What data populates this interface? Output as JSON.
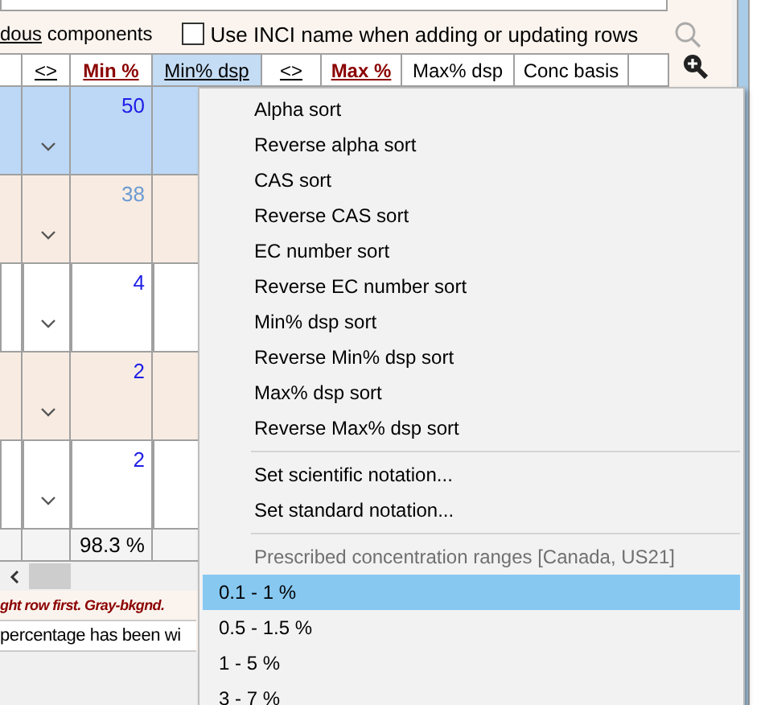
{
  "toolbar": {
    "link_text": "dous",
    "label": "components",
    "checkbox": {
      "label": "Use INCI name when adding or updating rows",
      "checked": false
    }
  },
  "table": {
    "columns": [
      {
        "kind": "plain",
        "selected": false
      },
      {
        "label": "<>",
        "kind": "toggle",
        "selected": false
      },
      {
        "label": "Min %",
        "kind": "key",
        "selected": false
      },
      {
        "label": "Min% dsp",
        "kind": "link",
        "selected": true
      },
      {
        "label": "<>",
        "kind": "toggle",
        "selected": false
      },
      {
        "label": "Max %",
        "kind": "key",
        "selected": false
      },
      {
        "label": "Max% dsp",
        "kind": "plain",
        "selected": false
      },
      {
        "label": "Conc basis",
        "kind": "plain",
        "selected": false
      },
      {
        "kind": "plain",
        "selected": false
      }
    ],
    "rows": [
      {
        "min": "50",
        "selected": true,
        "dimmed": false
      },
      {
        "min": "38",
        "selected": false,
        "dimmed": true
      },
      {
        "min": "4",
        "selected": false,
        "dimmed": false
      },
      {
        "min": "2",
        "selected": false,
        "dimmed": false
      },
      {
        "min": "2",
        "selected": false,
        "dimmed": false
      }
    ],
    "footer": {
      "min": "98.3 %"
    }
  },
  "status": {
    "warning": "ght row first. Gray-bkgnd.",
    "note": "percentage has been wi"
  },
  "menu": {
    "items": [
      {
        "kind": "action",
        "label": "Alpha sort",
        "selected": false
      },
      {
        "kind": "action",
        "label": "Reverse alpha sort",
        "selected": false
      },
      {
        "kind": "action",
        "label": "CAS sort",
        "selected": false
      },
      {
        "kind": "action",
        "label": "Reverse CAS sort",
        "selected": false
      },
      {
        "kind": "action",
        "label": "EC number sort",
        "selected": false
      },
      {
        "kind": "action",
        "label": "Reverse EC number sort",
        "selected": false
      },
      {
        "kind": "action",
        "label": "Min% dsp sort",
        "selected": false
      },
      {
        "kind": "action",
        "label": "Reverse Min% dsp sort",
        "selected": false
      },
      {
        "kind": "action",
        "label": "Max% dsp sort",
        "selected": false
      },
      {
        "kind": "action",
        "label": "Reverse Max% dsp sort",
        "selected": false
      },
      {
        "kind": "separator"
      },
      {
        "kind": "action",
        "label": "Set scientific notation...",
        "selected": false
      },
      {
        "kind": "action",
        "label": "Set standard notation...",
        "selected": false
      },
      {
        "kind": "separator"
      },
      {
        "kind": "header",
        "label": "Prescribed concentration ranges [Canada, US21]"
      },
      {
        "kind": "range",
        "label": "0.1 - 1 %",
        "selected": true
      },
      {
        "kind": "range",
        "label": "0.5 - 1.5 %",
        "selected": false
      },
      {
        "kind": "range",
        "label": "1 - 5 %",
        "selected": false
      },
      {
        "kind": "range",
        "label": "3 - 7 %",
        "selected": false
      }
    ]
  }
}
